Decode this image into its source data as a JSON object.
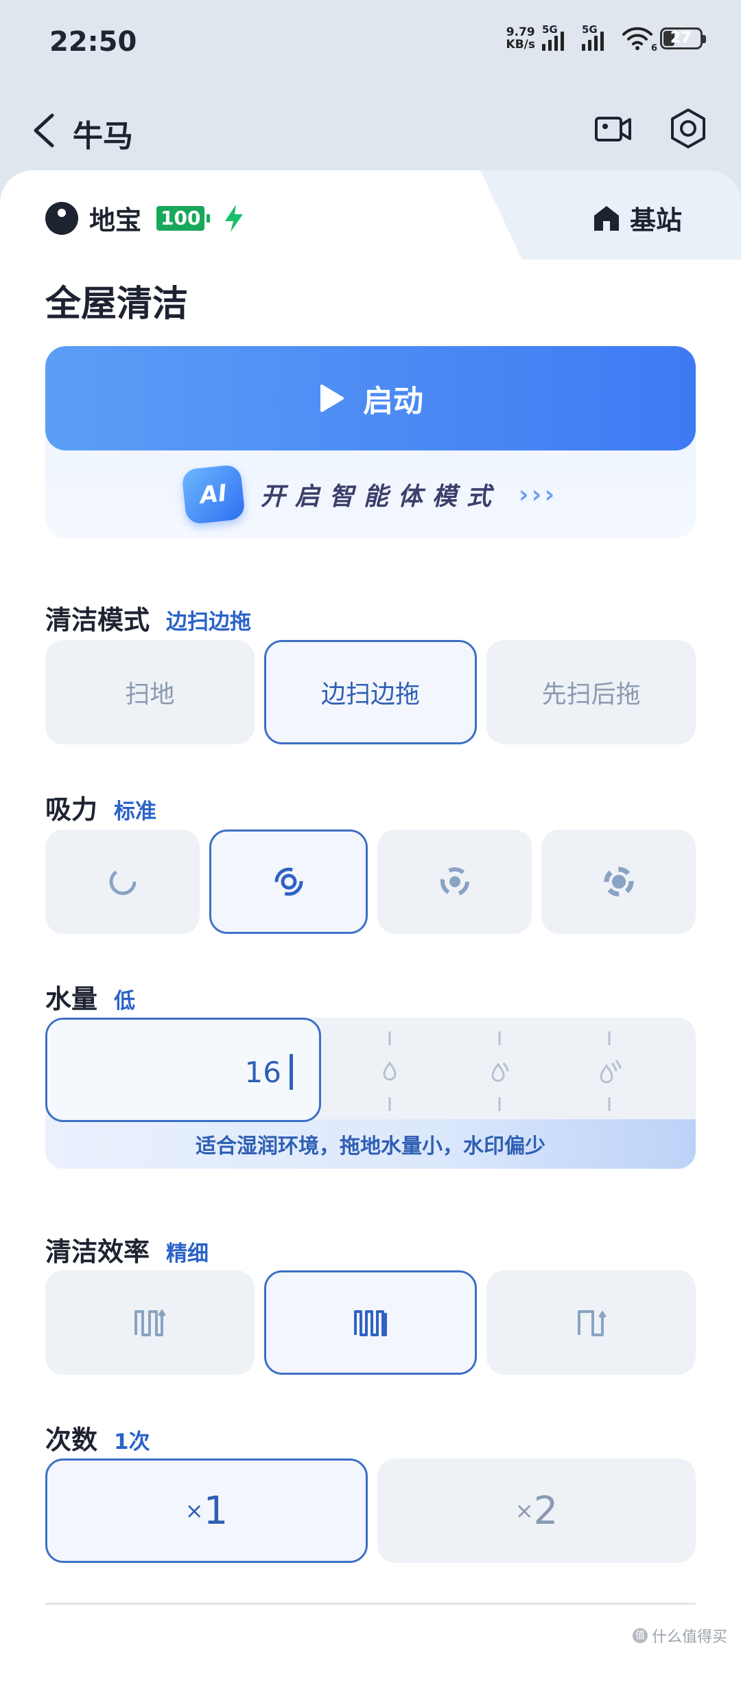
{
  "status": {
    "time": "22:50",
    "net_speed_value": "9.79",
    "net_speed_unit": "KB/s",
    "sim1": "5G",
    "sim2": "5G",
    "wifi_sub": "6",
    "battery": "27"
  },
  "header": {
    "title": "牛马"
  },
  "device": {
    "name": "地宝",
    "battery": "100",
    "station_label": "基站"
  },
  "main": {
    "section_title": "全屋清洁",
    "start_label": "启动",
    "ai_text": "开启智能体模式",
    "ai_badge": "AI",
    "ai_arrows": "›››"
  },
  "clean_mode": {
    "label": "清洁模式",
    "value": "边扫边拖",
    "options": [
      "扫地",
      "边扫边拖",
      "先扫后拖"
    ],
    "selected_index": 1
  },
  "suction": {
    "label": "吸力",
    "value": "标准",
    "levels": 4,
    "selected_index": 1
  },
  "water": {
    "label": "水量",
    "value": "低",
    "current": "16",
    "hint": "适合湿润环境，拖地水量小，水印偏少"
  },
  "efficiency": {
    "label": "清洁效率",
    "value": "精细",
    "selected_index": 1
  },
  "times": {
    "label": "次数",
    "value": "1次",
    "options": [
      {
        "prefix": "×",
        "num": "1"
      },
      {
        "prefix": "×",
        "num": "2"
      }
    ],
    "selected_index": 0
  },
  "watermark": {
    "text": "什么值得买",
    "badge": "值"
  },
  "colors": {
    "accent": "#3e7af3",
    "selected_border": "#3c6fc6",
    "battery_green": "#18a85a"
  }
}
